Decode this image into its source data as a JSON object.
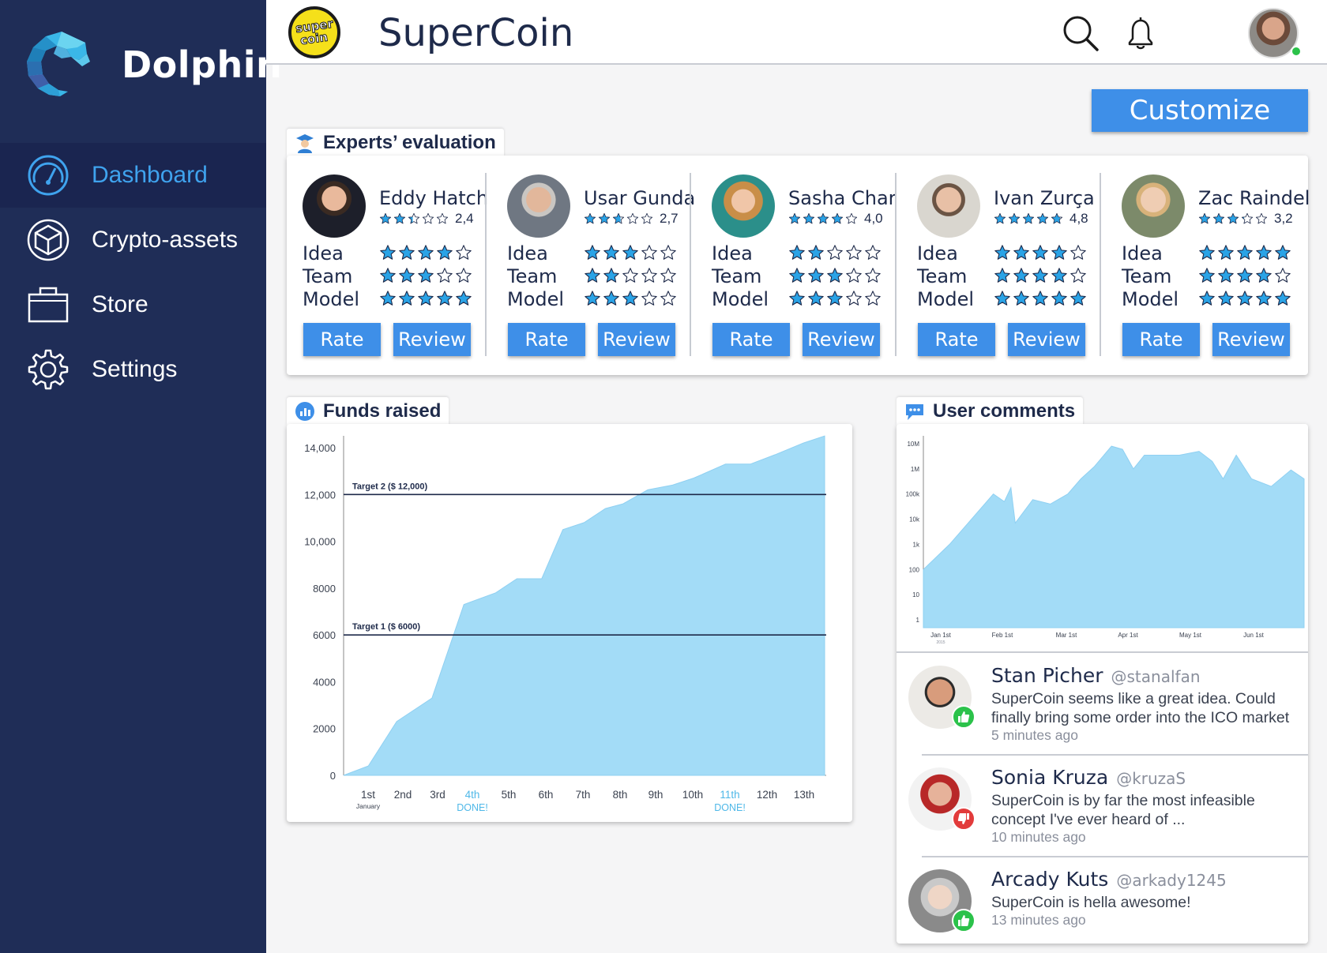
{
  "sidebar": {
    "brand": "Dolphin",
    "items": [
      {
        "label": "Dashboard",
        "icon": "dashboard-icon",
        "active": true
      },
      {
        "label": "Crypto-assets",
        "icon": "cube-icon",
        "active": false
      },
      {
        "label": "Store",
        "icon": "briefcase-icon",
        "active": false
      },
      {
        "label": "Settings",
        "icon": "gear-icon",
        "active": false
      }
    ]
  },
  "header": {
    "logo_top": "super",
    "logo_bottom": "coin",
    "title": "SuperCoin",
    "icons": [
      "search-icon",
      "bell-icon"
    ]
  },
  "customize_label": "Customize",
  "experts": {
    "title": "Experts’ evaluation",
    "criteria": [
      "Idea",
      "Team",
      "Model"
    ],
    "rate_label": "Rate",
    "review_label": "Review",
    "list": [
      {
        "name": "Eddy Hatch",
        "rating": "2,4",
        "rating_value": 2.4,
        "scores": [
          4,
          3,
          5
        ]
      },
      {
        "name": "Usar Gunda",
        "rating": "2,7",
        "rating_value": 2.7,
        "scores": [
          3,
          2,
          3
        ]
      },
      {
        "name": "Sasha Char",
        "rating": "4,0",
        "rating_value": 4.0,
        "scores": [
          2,
          3,
          3
        ]
      },
      {
        "name": "Ivan Zurça",
        "rating": "4,8",
        "rating_value": 4.8,
        "scores": [
          4,
          4,
          5
        ]
      },
      {
        "name": "Zac Raindel",
        "rating": "3,2",
        "rating_value": 3.2,
        "scores": [
          5,
          4,
          5
        ]
      }
    ]
  },
  "funds": {
    "title": "Funds raised",
    "chart_data": {
      "type": "area",
      "x": [
        "1st",
        "2nd",
        "3rd",
        "4th",
        "5th",
        "6th",
        "7th",
        "8th",
        "9th",
        "10th",
        "11th",
        "12th",
        "13th"
      ],
      "x_sub": {
        "1st": "January",
        "4th": "DONE!",
        "11th": "DONE!"
      },
      "highlight_x": [
        "4th",
        "11th"
      ],
      "y_ticks": [
        "0",
        "2000",
        "4000",
        "6000",
        "8000",
        "10,000",
        "12,000",
        "14,000"
      ],
      "ylim": [
        0,
        14000
      ],
      "points": [
        [
          0,
          0
        ],
        [
          0.7,
          400
        ],
        [
          1.5,
          2300
        ],
        [
          2.5,
          3300
        ],
        [
          3.4,
          7300
        ],
        [
          4.3,
          7800
        ],
        [
          4.9,
          8400
        ],
        [
          5.6,
          8400
        ],
        [
          6.2,
          10500
        ],
        [
          6.8,
          10800
        ],
        [
          7.4,
          11400
        ],
        [
          7.9,
          11600
        ],
        [
          8.6,
          12200
        ],
        [
          9.3,
          12400
        ],
        [
          9.9,
          12700
        ],
        [
          10.8,
          13300
        ],
        [
          11.5,
          13300
        ],
        [
          12.2,
          13700
        ],
        [
          13.0,
          14200
        ],
        [
          13.6,
          14500
        ]
      ],
      "targets": [
        {
          "label": "Target 2 ($ 12,000)",
          "value": 12000
        },
        {
          "label": "Target 1 ($ 6000)",
          "value": 6000
        }
      ],
      "color": "#a3dcf7"
    }
  },
  "comments": {
    "title": "User comments",
    "chart_data": {
      "type": "area",
      "scale": "log",
      "y_ticks": [
        "1",
        "10",
        "100",
        "1k",
        "10k",
        "100k",
        "1M",
        "10M"
      ],
      "x_ticks": [
        "Jan 1st",
        "Feb 1st",
        "Mar 1st",
        "Apr 1st",
        "May 1st",
        "Jun 1st"
      ],
      "x_sub": "2015",
      "points": [
        [
          0,
          100
        ],
        [
          0.6,
          1000
        ],
        [
          1.1,
          10000
        ],
        [
          1.6,
          100000
        ],
        [
          1.85,
          50000
        ],
        [
          2.0,
          180000
        ],
        [
          2.1,
          7000
        ],
        [
          2.5,
          60000
        ],
        [
          2.9,
          40000
        ],
        [
          3.3,
          100000
        ],
        [
          3.6,
          400000
        ],
        [
          3.9,
          1200000
        ],
        [
          4.3,
          8000000
        ],
        [
          4.55,
          6000000
        ],
        [
          4.8,
          1000000
        ],
        [
          5.05,
          3500000
        ],
        [
          5.5,
          3500000
        ],
        [
          5.85,
          3500000
        ],
        [
          6.3,
          5000000
        ],
        [
          6.6,
          2000000
        ],
        [
          6.85,
          400000
        ],
        [
          7.15,
          3500000
        ],
        [
          7.5,
          400000
        ],
        [
          7.95,
          200000
        ],
        [
          8.4,
          900000
        ],
        [
          8.7,
          400000
        ]
      ],
      "color": "#a3dcf7"
    },
    "list": [
      {
        "name": "Stan Picher",
        "handle": "@stanalfan",
        "text": "SuperCoin seems like a great idea. Could finally bring some order into the ICO market",
        "time": "5 minutes ago",
        "badge": "thumbs-up-icon",
        "badge_color": "#2bc24a"
      },
      {
        "name": "Sonia Kruza",
        "handle": "@kruzaS",
        "text": "SuperCoin is by far the most infeasible concept I've ever heard of ...",
        "time": "10 minutes ago",
        "badge": "thumbs-down-icon",
        "badge_color": "#e23b3b"
      },
      {
        "name": "Arcady Kuts",
        "handle": "@arkady1245",
        "text": "SuperCoin is hella awesome!",
        "time": "13 minutes ago",
        "badge": "thumbs-up-icon",
        "badge_color": "#2bc24a"
      }
    ]
  },
  "colors": {
    "sidebar": "#1f2d57",
    "accent": "#3e8fe8",
    "star": "#2aa3e6",
    "area": "#a3dcf7"
  }
}
